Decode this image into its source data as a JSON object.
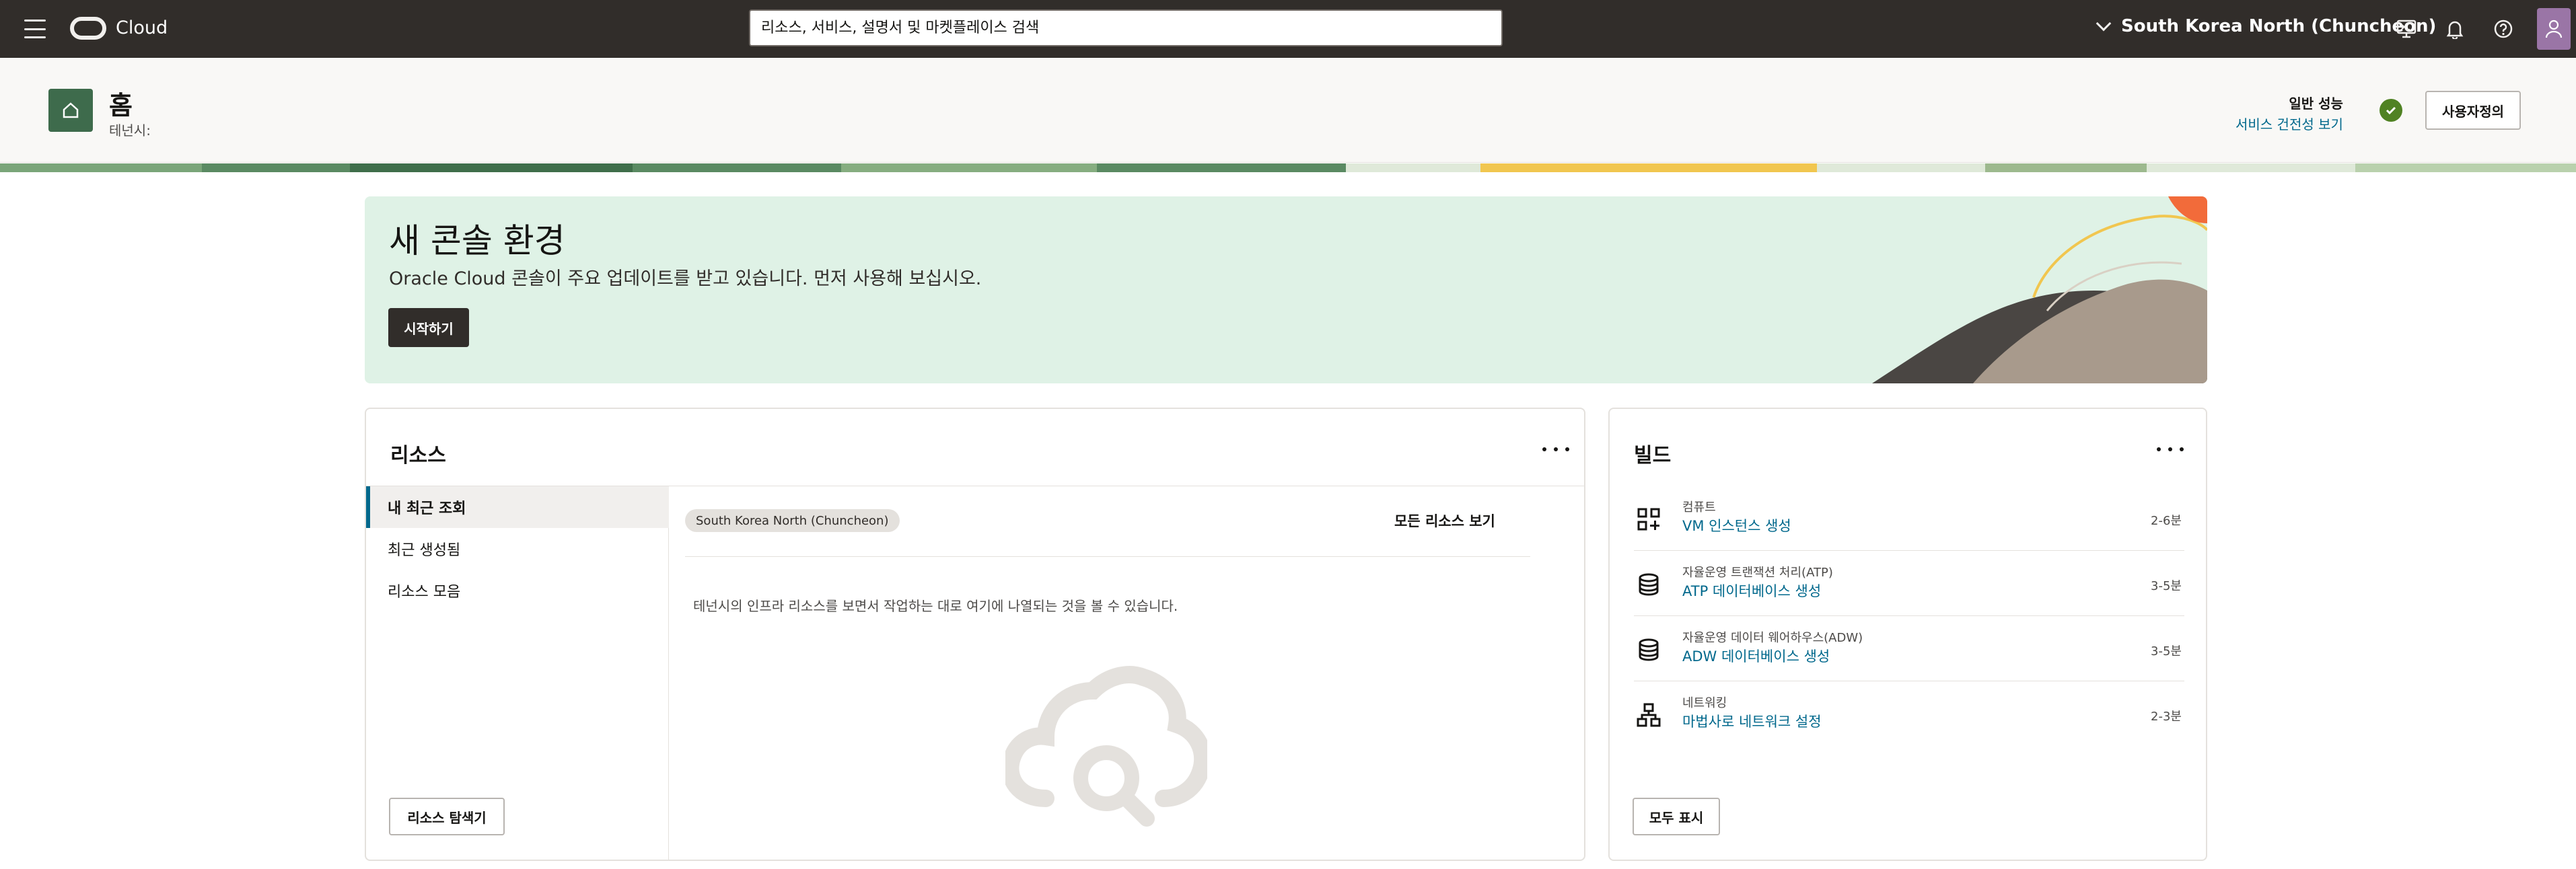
{
  "topbar": {
    "brand": "Cloud",
    "search_placeholder": "리소스, 서비스, 설명서 및 마켓플레이스 검색",
    "region": "South Korea North (Chuncheon)"
  },
  "header": {
    "title": "홈",
    "tenant_label": "테넌시:",
    "performance_label": "일반 성능",
    "health_link": "서비스 건전성 보기",
    "customize_button": "사용자정의"
  },
  "banner": {
    "title": "새 콘솔 환경",
    "text": "Oracle Cloud 콘솔이 주요 업데이트를 받고 있습니다. 먼저 사용해 보십시오.",
    "button": "시작하기"
  },
  "resources": {
    "title": "리소스",
    "nav": [
      {
        "label": "내 최근 조회"
      },
      {
        "label": "최근 생성됨"
      },
      {
        "label": "리소스 모음"
      }
    ],
    "region_chip": "South Korea North (Chuncheon)",
    "view_all": "모든 리소스 보기",
    "empty_text": "테넌시의 인프라 리소스를 보면서 작업하는 대로 여기에 나열되는 것을 볼 수 있습니다.",
    "explorer_button": "리소스 탐색기"
  },
  "build": {
    "title": "빌드",
    "items": [
      {
        "category": "컴퓨트",
        "link": "VM 인스턴스 생성",
        "time": "2-6분",
        "icon": "compute-icon"
      },
      {
        "category": "자율운영 트랜잭션 처리(ATP)",
        "link": "ATP 데이터베이스 생성",
        "time": "3-5분",
        "icon": "database-icon"
      },
      {
        "category": "자율운영 데이터 웨어하우스(ADW)",
        "link": "ADW 데이터베이스 생성",
        "time": "3-5분",
        "icon": "database-icon"
      },
      {
        "category": "네트워킹",
        "link": "마법사로 네트워크 설정",
        "time": "2-3분",
        "icon": "network-icon"
      }
    ],
    "show_all_button": "모두 표시"
  },
  "colors": {
    "topbar": "#312d2a",
    "link": "#00688c",
    "banner": "#dff2e6",
    "home_tile": "#3e6b4c",
    "status_ok": "#508223"
  }
}
